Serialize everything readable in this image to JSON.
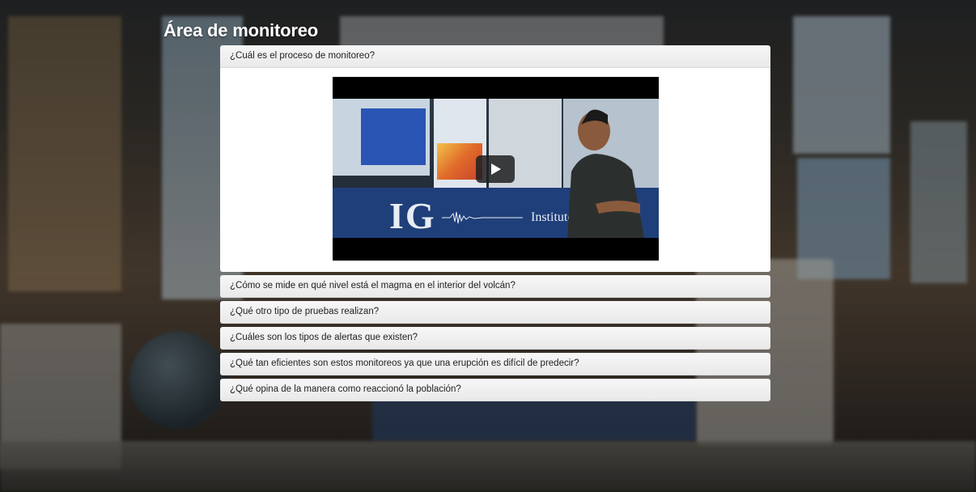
{
  "page": {
    "title": "Área de monitoreo"
  },
  "accordion": {
    "items": [
      {
        "label": "¿Cuál es el proceso de monitoreo?",
        "expanded": true
      },
      {
        "label": "¿Cómo se mide en qué nivel está el magma en el interior del volcán?",
        "expanded": false
      },
      {
        "label": "¿Qué otro tipo de pruebas realizan?",
        "expanded": false
      },
      {
        "label": "¿Cuáles son los tipos de alertas que existen?",
        "expanded": false
      },
      {
        "label": "¿Qué tan eficientes son estos monitoreos ya que una erupción es difícil de predecir?",
        "expanded": false
      },
      {
        "label": "¿Qué opina de la manera como reaccionó la población?",
        "expanded": false
      }
    ]
  },
  "video": {
    "logo_text": "IG",
    "banner_text": "Instituto G",
    "play_icon": "play-icon"
  }
}
